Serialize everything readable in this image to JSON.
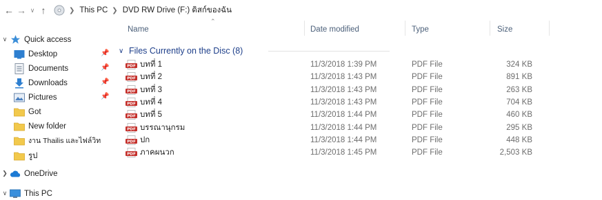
{
  "address": {
    "path": [
      {
        "label": "This PC"
      },
      {
        "label": "DVD RW Drive (F:) ดิสก์ของฉัน"
      }
    ]
  },
  "nav": {
    "items": [
      {
        "label": "Quick access",
        "icon": "star-icon",
        "pinned": false
      },
      {
        "label": "Desktop",
        "icon": "desktop-icon",
        "pinned": true
      },
      {
        "label": "Documents",
        "icon": "documents-icon",
        "pinned": true
      },
      {
        "label": "Downloads",
        "icon": "downloads-icon",
        "pinned": true
      },
      {
        "label": "Pictures",
        "icon": "pictures-icon",
        "pinned": true
      },
      {
        "label": "Got",
        "icon": "folder-icon",
        "pinned": false
      },
      {
        "label": "New folder",
        "icon": "folder-icon",
        "pinned": false
      },
      {
        "label": "งาน Thailis และไฟล์วิท",
        "icon": "folder-icon",
        "pinned": false
      },
      {
        "label": "รูป",
        "icon": "folder-icon",
        "pinned": false
      },
      {
        "label": "OneDrive",
        "icon": "onedrive-icon",
        "pinned": false
      },
      {
        "label": "This PC",
        "icon": "this-pc-icon",
        "pinned": false
      }
    ]
  },
  "columns": {
    "name": "Name",
    "date": "Date modified",
    "type": "Type",
    "size": "Size"
  },
  "group": {
    "title": "Files Currently on the Disc (8)"
  },
  "files": [
    {
      "name": "บทที่ 1",
      "date": "11/3/2018 1:39 PM",
      "type": "PDF File",
      "size": "324 KB"
    },
    {
      "name": "บทที่ 2",
      "date": "11/3/2018 1:43 PM",
      "type": "PDF File",
      "size": "891 KB"
    },
    {
      "name": "บทที่ 3",
      "date": "11/3/2018 1:43 PM",
      "type": "PDF File",
      "size": "263 KB"
    },
    {
      "name": "บทที่ 4",
      "date": "11/3/2018 1:43 PM",
      "type": "PDF File",
      "size": "704 KB"
    },
    {
      "name": "บทที่ 5",
      "date": "11/3/2018 1:44 PM",
      "type": "PDF File",
      "size": "460 KB"
    },
    {
      "name": "บรรณานุกรม",
      "date": "11/3/2018 1:44 PM",
      "type": "PDF File",
      "size": "295 KB"
    },
    {
      "name": "ปก",
      "date": "11/3/2018 1:44 PM",
      "type": "PDF File",
      "size": "448 KB"
    },
    {
      "name": "ภาคผนวก",
      "date": "11/3/2018 1:45 PM",
      "type": "PDF File",
      "size": "2,503 KB"
    }
  ],
  "colors": {
    "accent": "#1e3f8a",
    "header_text": "#4c607a",
    "secondary_text": "#6d6d6d",
    "folder": "#f2c94c",
    "pdf_red": "#c4302b"
  }
}
